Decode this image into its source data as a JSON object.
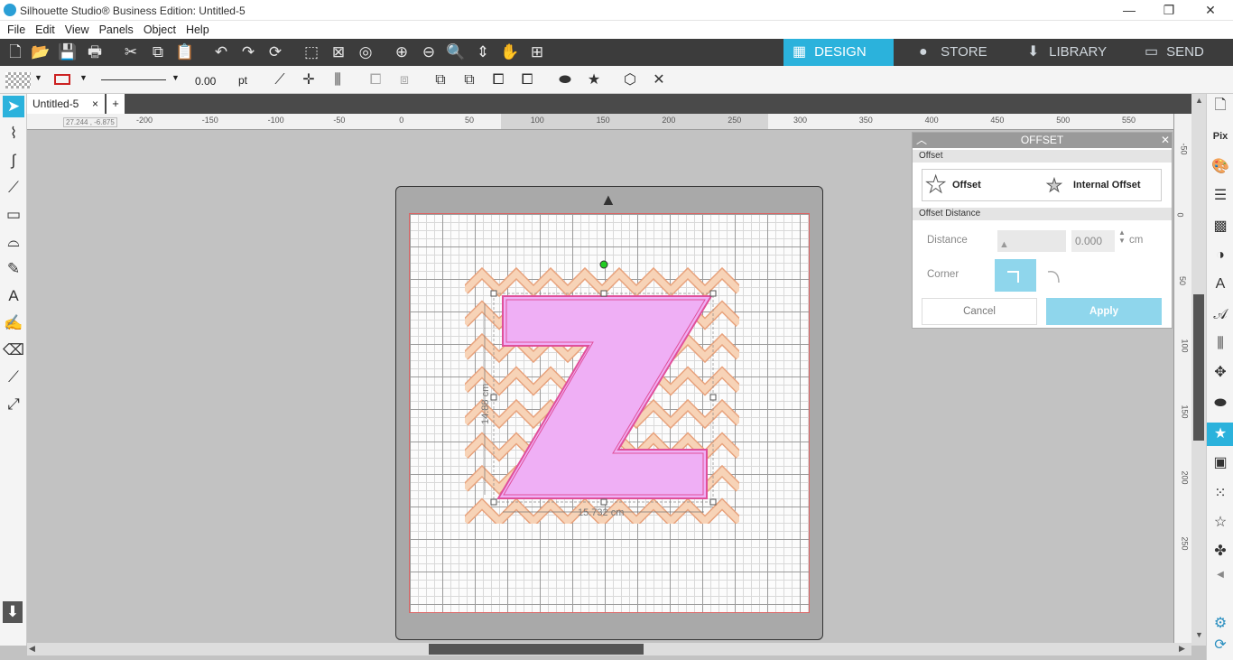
{
  "window": {
    "title": "Silhouette Studio® Business Edition: Untitled-5",
    "minimize": "—",
    "restore": "❐",
    "close": "✕"
  },
  "menu": [
    "File",
    "Edit",
    "View",
    "Panels",
    "Object",
    "Help"
  ],
  "nav_tabs": [
    {
      "label": "DESIGN",
      "icon": "grid-icon",
      "active": true
    },
    {
      "label": "STORE",
      "icon": "silhouette-s-icon",
      "active": false
    },
    {
      "label": "LIBRARY",
      "icon": "download-box-icon",
      "active": false
    },
    {
      "label": "SEND",
      "icon": "cutter-icon",
      "active": false
    }
  ],
  "line_width": {
    "value": "0.00",
    "unit": "pt"
  },
  "document": {
    "tab": "Untitled-5",
    "close": "×",
    "add": "+"
  },
  "cursor_coords": "27.244 , -6.875",
  "ruler_top": [
    "-200",
    "-150",
    "-100",
    "-50",
    "0",
    "50",
    "100",
    "150",
    "200",
    "250",
    "300",
    "350",
    "400",
    "450",
    "500",
    "550"
  ],
  "ruler_right": [
    "-50",
    "0",
    "50",
    "100",
    "150",
    "200",
    "250"
  ],
  "dimensions": {
    "width": "15.732 cm",
    "height": "14.88 cm"
  },
  "offset_panel": {
    "title": "OFFSET",
    "section_offset": "Offset",
    "offset_button": "Offset",
    "internal_offset_button": "Internal Offset",
    "section_distance": "Offset Distance",
    "distance_label": "Distance",
    "distance_value": "0.000",
    "distance_unit": "cm",
    "corner_label": "Corner",
    "cancel": "Cancel",
    "apply": "Apply"
  },
  "colors": {
    "accent": "#2bb2dc",
    "shape_fill": "#efaff5",
    "shape_stroke": "#e0509a",
    "chevron_fill": "#f7d3b7",
    "chevron_stroke": "#e8a27c",
    "arrow": "#e41414"
  }
}
